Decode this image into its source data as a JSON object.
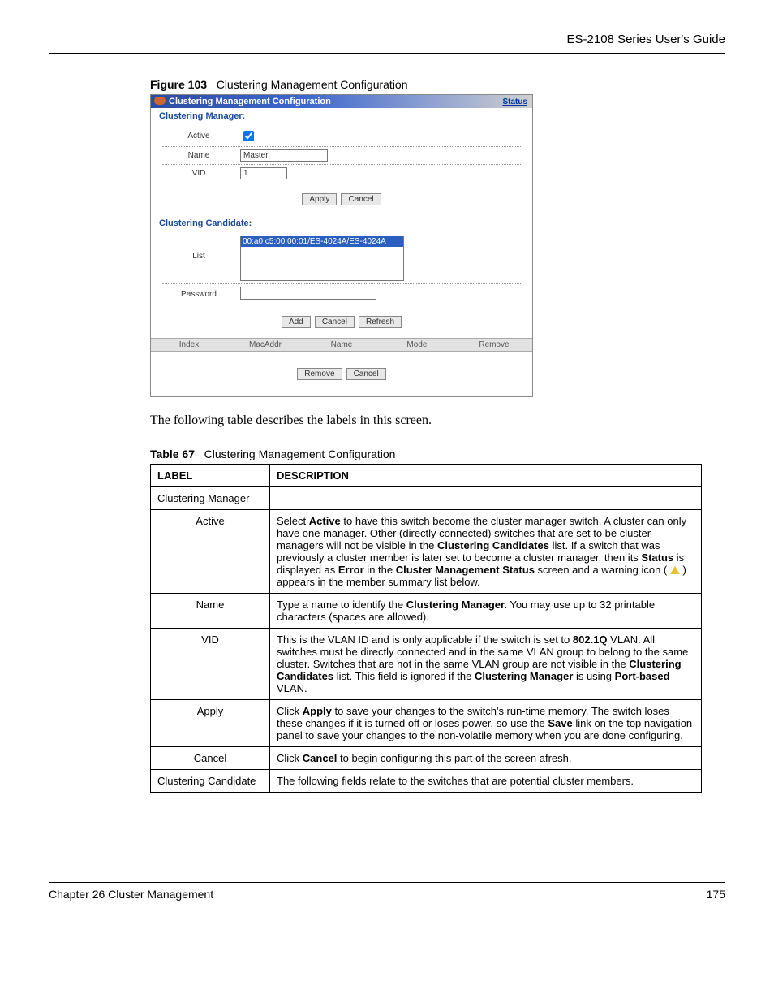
{
  "header": {
    "title": "ES-2108 Series User's Guide"
  },
  "figure": {
    "number": "Figure 103",
    "title": "Clustering Management Configuration"
  },
  "screenshot": {
    "title": "Clustering Management Configuration",
    "status_link": "Status",
    "manager_section": "Clustering Manager:",
    "fields": {
      "active_label": "Active",
      "name_label": "Name",
      "name_value": "Master",
      "vid_label": "VID",
      "vid_value": "1"
    },
    "buttons1": {
      "apply": "Apply",
      "cancel": "Cancel"
    },
    "candidate_section": "Clustering Candidate:",
    "candidate": {
      "list_label": "List",
      "list_item": "00:a0:c5:00:00:01/ES-4024A/ES-4024A",
      "password_label": "Password"
    },
    "buttons2": {
      "add": "Add",
      "cancel": "Cancel",
      "refresh": "Refresh"
    },
    "grid": {
      "col1": "Index",
      "col2": "MacAddr",
      "col3": "Name",
      "col4": "Model",
      "col5": "Remove"
    },
    "buttons3": {
      "remove": "Remove",
      "cancel": "Cancel"
    }
  },
  "body_text": "The following table describes the labels in this screen.",
  "table": {
    "number": "Table 67",
    "title": "Clustering Management Configuration",
    "header": {
      "label": "LABEL",
      "desc": "DESCRIPTION"
    },
    "rows": [
      {
        "label": "Clustering Manager",
        "desc": "",
        "centered": false
      },
      {
        "label": "Active",
        "desc_html": "Select <b>Active</b> to have this switch become the cluster manager switch. A cluster can only have one manager. Other (directly connected) switches that are set to be cluster managers will not be visible in the <b>Clustering Candidates</b> list. If a switch that was previously a cluster member is later set to become a cluster manager, then its <b>Status</b> is displayed as <b>Error</b> in the <b>Cluster Management Status</b> screen and a warning icon ( <span class=\"warn-icon\"></span> ) appears in the member summary list below.",
        "centered": true
      },
      {
        "label": "Name",
        "desc_html": "Type a name to identify the <b>Clustering Manager.</b> You may use up to 32 printable characters (spaces are allowed).",
        "centered": true
      },
      {
        "label": "VID",
        "desc_html": "This is the VLAN ID and is only applicable if the switch is set to <b>802.1Q</b> VLAN. All switches must be directly connected and in the same VLAN group to belong to the same cluster. Switches that are not in the same VLAN group are not visible in the <b>Clustering Candidates</b> list. This field is ignored if the <b>Clustering Manager</b> is using <b>Port-based</b> VLAN.",
        "centered": true
      },
      {
        "label": "Apply",
        "desc_html": "Click <b>Apply</b> to save your changes to the switch's run-time memory. The switch loses these changes if it is turned off or loses power, so use the <b>Save</b> link on the top navigation panel to save your changes to the non-volatile memory when you are done configuring.",
        "centered": true
      },
      {
        "label": "Cancel",
        "desc_html": "Click <b>Cancel</b> to begin configuring this part of the screen afresh.",
        "centered": true
      },
      {
        "label": "Clustering Candidate",
        "desc_html": "The following fields relate to the switches that are potential cluster members.",
        "centered": false
      }
    ]
  },
  "footer": {
    "chapter": "Chapter 26 Cluster Management",
    "page": "175"
  }
}
